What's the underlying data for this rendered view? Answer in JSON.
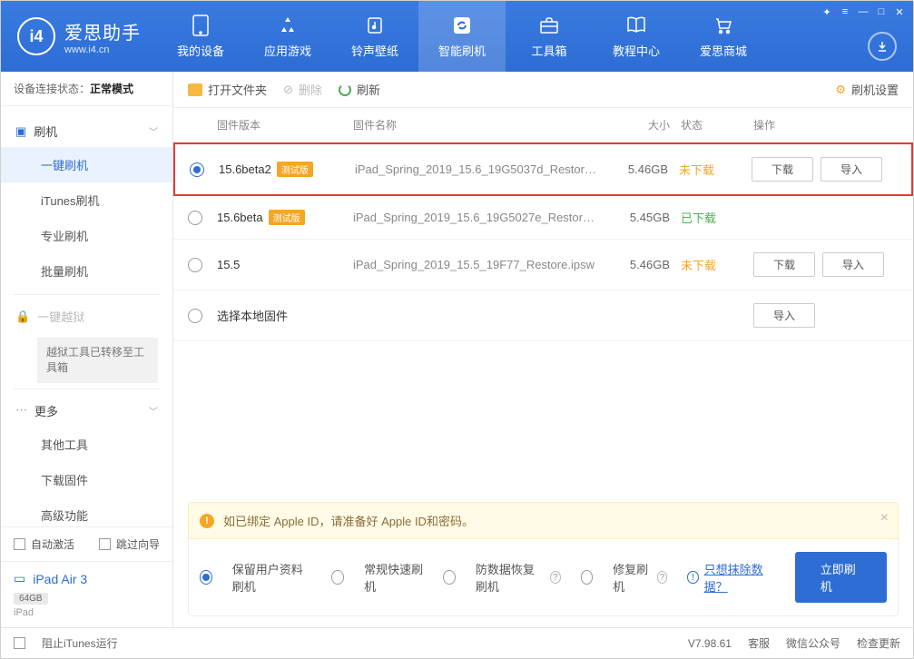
{
  "app": {
    "name_cn": "爱思助手",
    "name_en": "www.i4.cn"
  },
  "nav": [
    {
      "label": "我的设备"
    },
    {
      "label": "应用游戏"
    },
    {
      "label": "铃声壁纸"
    },
    {
      "label": "智能刷机"
    },
    {
      "label": "工具箱"
    },
    {
      "label": "教程中心"
    },
    {
      "label": "爱思商城"
    }
  ],
  "sidebar": {
    "conn_label": "设备连接状态：",
    "conn_value": "正常模式",
    "g1": "刷机",
    "g1_items": [
      "一键刷机",
      "iTunes刷机",
      "专业刷机",
      "批量刷机"
    ],
    "jailbreak": "一键越狱",
    "jailbreak_note": "越狱工具已转移至工具箱",
    "more": "更多",
    "more_items": [
      "其他工具",
      "下载固件",
      "高级功能"
    ],
    "auto_activate": "自动激活",
    "skip_guide": "跳过向导",
    "device_name": "iPad Air 3",
    "device_storage": "64GB",
    "device_type": "iPad"
  },
  "toolbar": {
    "open_folder": "打开文件夹",
    "delete": "删除",
    "refresh": "刷新",
    "settings": "刷机设置"
  },
  "table": {
    "h_ver": "固件版本",
    "h_name": "固件名称",
    "h_size": "大小",
    "h_status": "状态",
    "h_act": "操作",
    "btn_download": "下载",
    "btn_import": "导入",
    "local": "选择本地固件",
    "rows": [
      {
        "ver": "15.6beta2",
        "beta": "测试版",
        "name": "iPad_Spring_2019_15.6_19G5037d_Restore.i...",
        "size": "5.46GB",
        "status": "未下载",
        "status_cls": "pending",
        "checked": true,
        "highlight": true,
        "dl": true,
        "imp": true
      },
      {
        "ver": "15.6beta",
        "beta": "测试版",
        "name": "iPad_Spring_2019_15.6_19G5027e_Restore.ip...",
        "size": "5.45GB",
        "status": "已下载",
        "status_cls": "done",
        "checked": false,
        "highlight": false,
        "dl": false,
        "imp": false
      },
      {
        "ver": "15.5",
        "beta": "",
        "name": "iPad_Spring_2019_15.5_19F77_Restore.ipsw",
        "size": "5.46GB",
        "status": "未下载",
        "status_cls": "pending",
        "checked": false,
        "highlight": false,
        "dl": true,
        "imp": true
      }
    ]
  },
  "alert": "如已绑定 Apple ID，请准备好 Apple ID和密码。",
  "options": {
    "o1": "保留用户资料刷机",
    "o2": "常规快速刷机",
    "o3": "防数据恢复刷机",
    "o4": "修复刷机",
    "link": "只想抹除数据？",
    "go": "立即刷机"
  },
  "footer": {
    "block_itunes": "阻止iTunes运行",
    "version": "V7.98.61",
    "f1": "客服",
    "f2": "微信公众号",
    "f3": "检查更新"
  }
}
